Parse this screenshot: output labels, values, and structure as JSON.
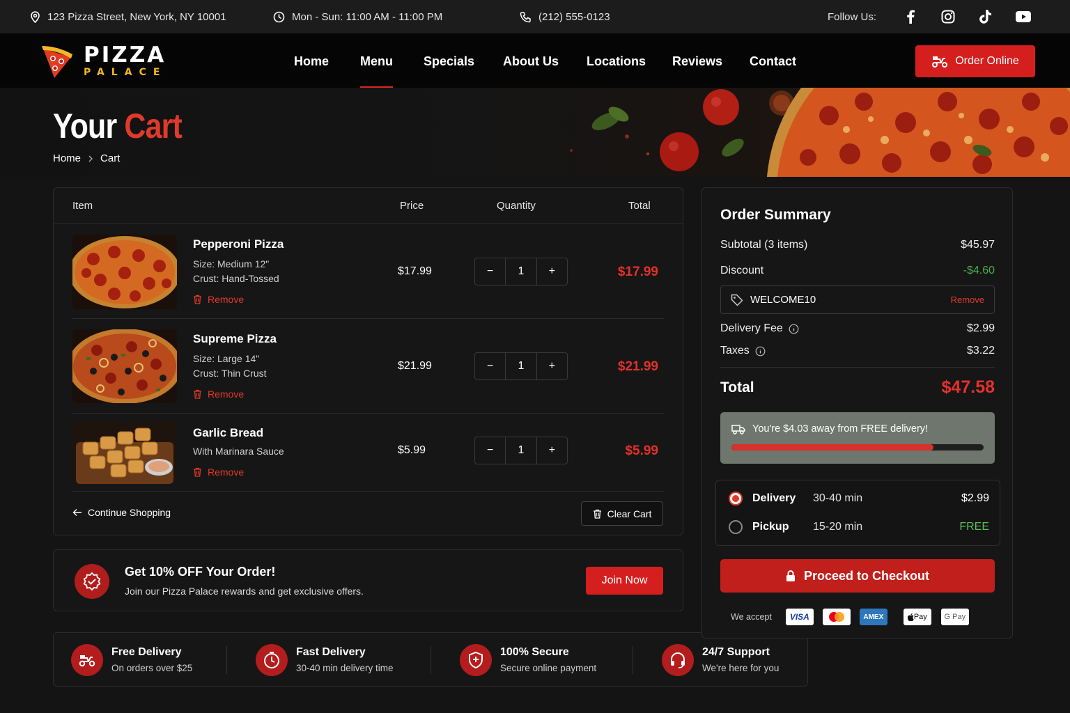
{
  "topbar": {
    "address": "123 Pizza Street, New York, NY 10001",
    "hours": "Mon - Sun: 11:00 AM - 11:00 PM",
    "phone": "(212) 555-0123",
    "follow_label": "Follow Us:"
  },
  "brand": {
    "line1": "PIZZA",
    "line2": "PALACE"
  },
  "nav": {
    "items": [
      "Home",
      "Menu",
      "Specials",
      "About Us",
      "Locations",
      "Reviews",
      "Contact"
    ],
    "active": "Menu",
    "order_label": "Order Online"
  },
  "hero": {
    "title_white": "Your",
    "title_red": "Cart",
    "breadcrumb": [
      "Home",
      "Cart"
    ]
  },
  "cart": {
    "headers": {
      "item": "Item",
      "price": "Price",
      "quantity": "Quantity",
      "total": "Total"
    },
    "items": [
      {
        "name": "Pepperoni Pizza",
        "detail1": "Size: Medium 12\"",
        "detail2": "Crust: Hand-Tossed",
        "price": "$17.99",
        "qty": "1",
        "total": "$17.99"
      },
      {
        "name": "Supreme Pizza",
        "detail1": "Size: Large 14\"",
        "detail2": "Crust: Thin Crust",
        "price": "$21.99",
        "qty": "1",
        "total": "$21.99"
      },
      {
        "name": "Garlic Bread",
        "detail1": "With Marinara Sauce",
        "detail2": "",
        "price": "$5.99",
        "qty": "1",
        "total": "$5.99"
      }
    ],
    "remove_label": "Remove",
    "qty_minus": "−",
    "qty_plus": "+",
    "continue_label": "Continue Shopping",
    "clear_label": "Clear Cart"
  },
  "promo": {
    "title": "Get 10% OFF Your Order!",
    "subtitle": "Join our Pizza Palace rewards and get exclusive offers.",
    "button": "Join Now"
  },
  "features": [
    {
      "title": "Free Delivery",
      "sub": "On orders over $25",
      "icon": "scooter-icon"
    },
    {
      "title": "Fast Delivery",
      "sub": "30-40 min delivery time",
      "icon": "clock-icon"
    },
    {
      "title": "100% Secure",
      "sub": "Secure online payment",
      "icon": "shield-icon"
    },
    {
      "title": "24/7 Support",
      "sub": "We're here for you",
      "icon": "headset-icon"
    }
  ],
  "summary": {
    "title": "Order Summary",
    "subtotal_label": "Subtotal (3 items)",
    "subtotal_value": "$45.97",
    "discount_label": "Discount",
    "discount_value": "-$4.60",
    "coupon_code": "WELCOME10",
    "coupon_remove": "Remove",
    "delivery_label": "Delivery Fee",
    "delivery_value": "$2.99",
    "taxes_label": "Taxes",
    "taxes_value": "$3.22",
    "total_label": "Total",
    "total_value": "$47.58",
    "free_msg": "You're $4.03 away from FREE delivery!",
    "free_progress": 0.8,
    "options": [
      {
        "name": "Delivery",
        "time": "30-40 min",
        "price": "$2.99",
        "selected": true
      },
      {
        "name": "Pickup",
        "time": "15-20 min",
        "price": "FREE",
        "selected": false
      }
    ],
    "checkout_label": "Proceed to Checkout",
    "accept_label": "We accept",
    "payments": [
      "VISA",
      "Mastercard",
      "AMEX",
      "Pay",
      "G Pay"
    ]
  },
  "colors": {
    "accent": "#d51f1f",
    "price_red": "#e4312b",
    "discount_green": "#4caf50",
    "free_green": "#5fbf58",
    "gold": "#f2b824"
  }
}
